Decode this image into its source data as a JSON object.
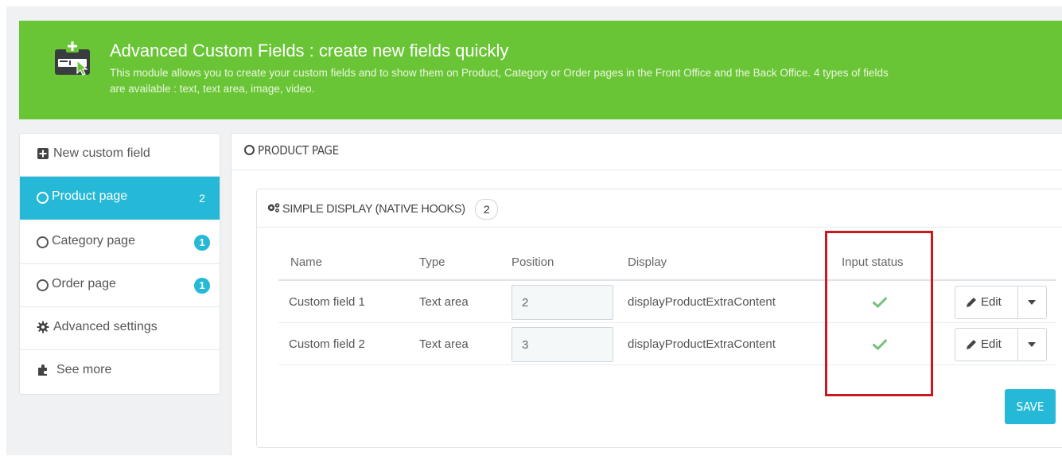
{
  "banner": {
    "title": "Advanced Custom Fields : create new fields quickly",
    "description": "This module allows you to create your custom fields and to show them on Product, Category or Order pages in the Front Office and the Back Office. 4 types of fields are available : text, text area, image, video.",
    "icon": "module-icon",
    "color": "#6ac536"
  },
  "sidebar": {
    "items": [
      {
        "label": "New custom field",
        "icon": "plus-square-icon",
        "active": false,
        "badge": ""
      },
      {
        "label": "Product page",
        "icon": "circle-icon",
        "active": true,
        "badge": "2"
      },
      {
        "label": "Category page",
        "icon": "circle-icon",
        "active": false,
        "badge": "1"
      },
      {
        "label": "Order page",
        "icon": "circle-icon",
        "active": false,
        "badge": "1"
      },
      {
        "label": "Advanced settings",
        "icon": "gear-icon",
        "active": false,
        "badge": ""
      },
      {
        "label": "See more",
        "icon": "puzzle-icon",
        "active": false,
        "badge": ""
      }
    ],
    "accent": "#25b9d7"
  },
  "main": {
    "heading": "PRODUCT PAGE",
    "section": {
      "heading": "SIMPLE DISPLAY (NATIVE HOOKS)",
      "count": "2",
      "columns": [
        "Name",
        "Type",
        "Position",
        "Display",
        "Input status"
      ],
      "rows": [
        {
          "name": "Custom field 1",
          "type": "Text area",
          "position": "2",
          "display": "displayProductExtraContent",
          "status": "enabled",
          "action": "Edit"
        },
        {
          "name": "Custom field 2",
          "type": "Text area",
          "position": "3",
          "display": "displayProductExtraContent",
          "status": "enabled",
          "action": "Edit"
        }
      ]
    },
    "save_label": "SAVE",
    "highlight_color": "#c9191e",
    "check_color": "#72c279"
  }
}
